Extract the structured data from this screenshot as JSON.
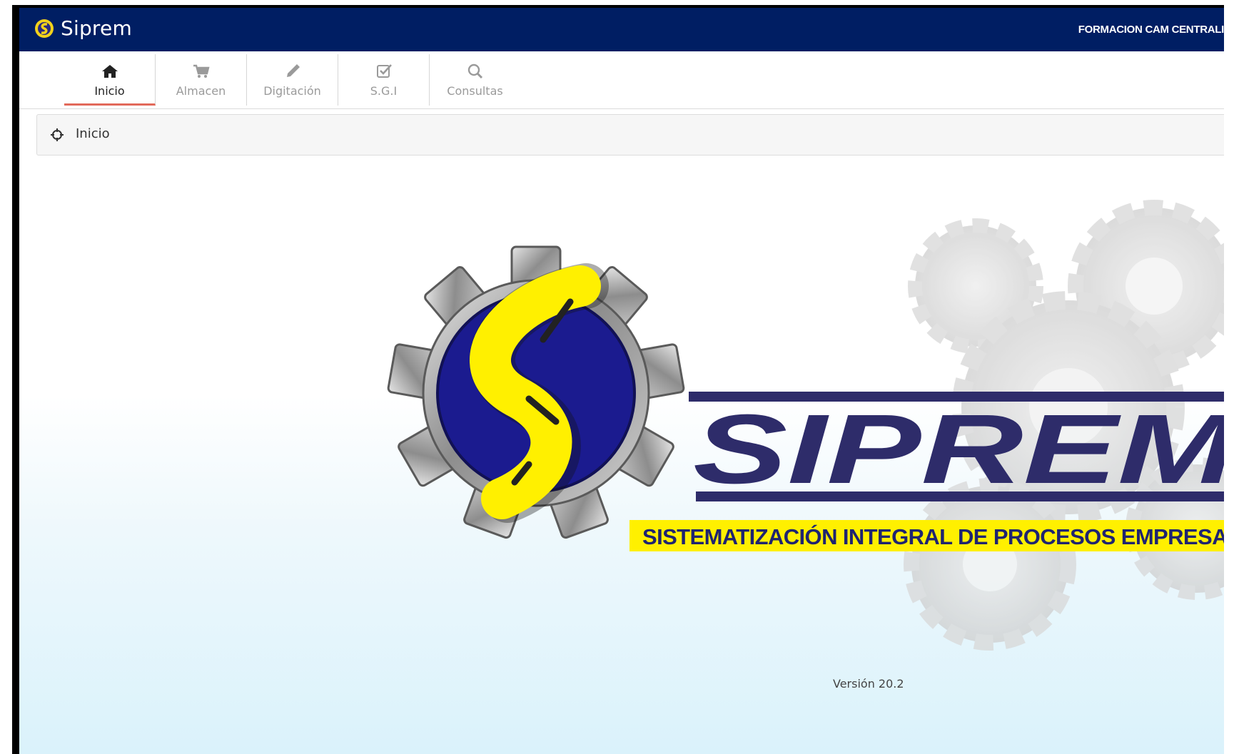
{
  "app": {
    "name": "Siprem",
    "user": "FORMACION CAM CENTRALI"
  },
  "nav": {
    "items": [
      {
        "label": "Inicio",
        "icon": "home-icon",
        "active": true
      },
      {
        "label": "Almacen",
        "icon": "cart-icon",
        "active": false
      },
      {
        "label": "Digitación",
        "icon": "pencil-icon",
        "active": false
      },
      {
        "label": "S.G.I",
        "icon": "checkbox-icon",
        "active": false
      },
      {
        "label": "Consultas",
        "icon": "search-icon",
        "active": false
      }
    ]
  },
  "breadcrumb": {
    "label": "Inicio",
    "icon": "crosshair-icon"
  },
  "logo": {
    "wordmark": "SIPREM",
    "tagline": "SISTEMATIZACIÓN INTEGRAL DE PROCESOS EMPRESARIALES"
  },
  "version": "Versión 20.2",
  "colors": {
    "topbar": "#001e63",
    "active_tab_underline": "#e26a5a",
    "logo_blue": "#1b1b8f",
    "logo_yellow": "#fff000",
    "wordmark": "#2e2c6a"
  }
}
